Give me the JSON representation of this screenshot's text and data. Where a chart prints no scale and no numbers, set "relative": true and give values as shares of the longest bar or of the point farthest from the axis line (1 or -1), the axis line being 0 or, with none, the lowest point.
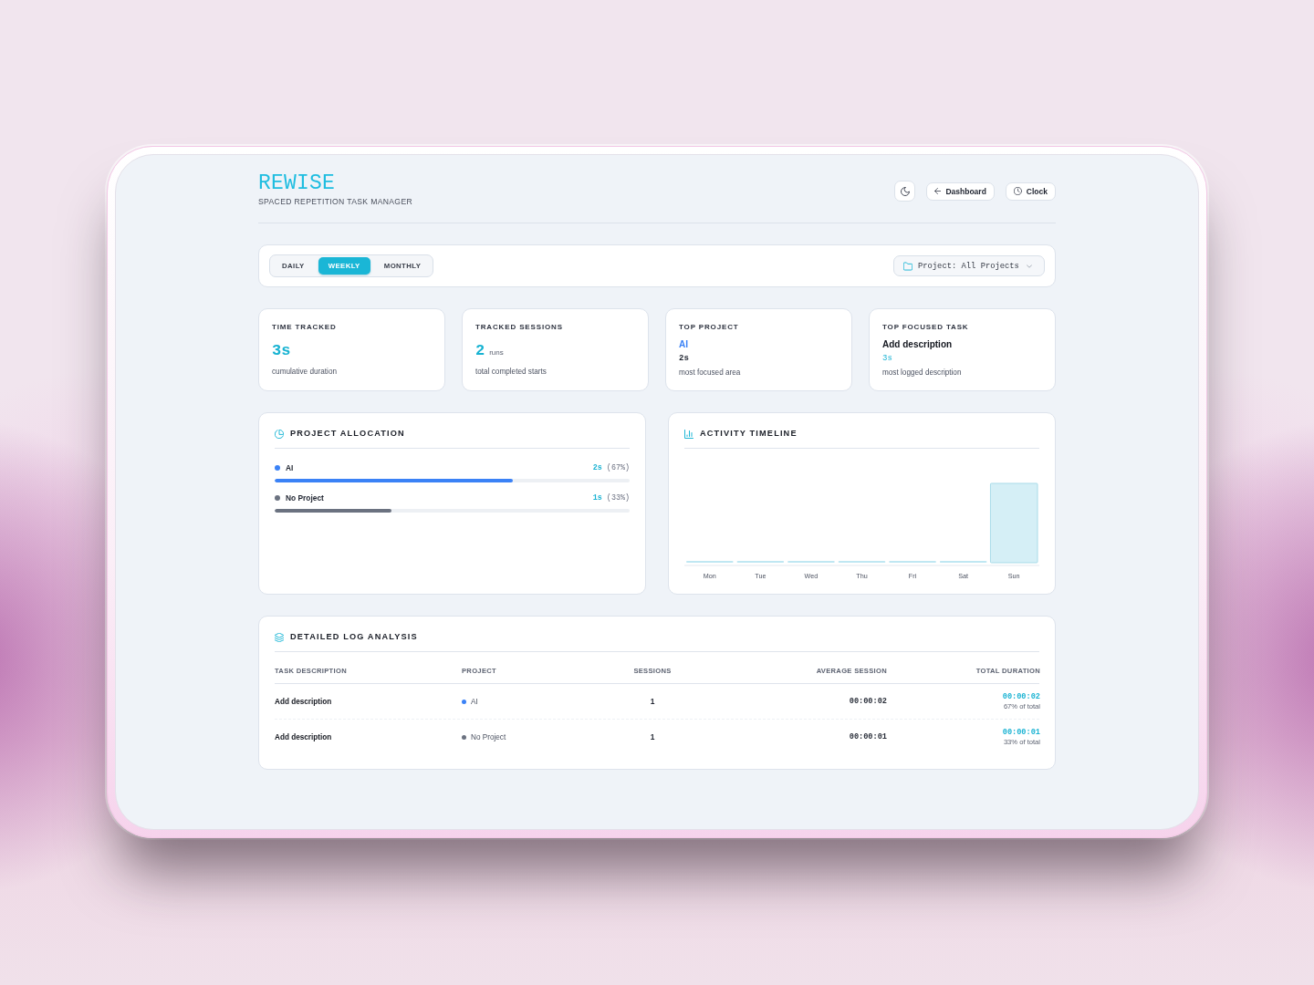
{
  "header": {
    "logo": "REWISE",
    "subtitle": "SPACED REPETITION TASK MANAGER",
    "buttons": [
      {
        "kind": "theme"
      },
      {
        "kind": "back",
        "label": "Dashboard"
      },
      {
        "kind": "clock",
        "label": "Clock"
      }
    ]
  },
  "filter_bar": {
    "tabs": [
      {
        "label": "DAILY",
        "selected": false
      },
      {
        "label": "WEEKLY",
        "selected": true
      },
      {
        "label": "MONTHLY",
        "selected": false
      }
    ],
    "project_select": {
      "value": "Project: All Projects"
    }
  },
  "stats": [
    {
      "kind": "metric",
      "label": "TIME TRACKED",
      "value": "3s",
      "description": "cumulative duration"
    },
    {
      "kind": "metric",
      "label": "TRACKED SESSIONS",
      "value": "2",
      "unit": "runs",
      "description": "total completed starts"
    },
    {
      "kind": "project",
      "label": "TOP PROJECT",
      "name": "AI",
      "value": "2s",
      "description": "most focused area"
    },
    {
      "kind": "task",
      "label": "TOP FOCUSED TASK",
      "name": "Add description",
      "value": "3s",
      "description": "most logged description"
    }
  ],
  "project_allocation": {
    "title": "PROJECT ALLOCATION",
    "items": [
      {
        "name": "AI",
        "color": "#3b82f6",
        "duration": "2s",
        "share": "(67%)",
        "level": 0.67
      },
      {
        "name": "No Project",
        "color": "#6b7280",
        "duration": "1s",
        "share": "(33%)",
        "level": 0.33
      }
    ]
  },
  "activity_timeline": {
    "title": "ACTIVITY TIMELINE",
    "chart_data": {
      "type": "bar",
      "relative": true,
      "categories": [
        "Mon",
        "Tue",
        "Wed",
        "Thu",
        "Fri",
        "Sat",
        "Sun"
      ],
      "values": [
        0,
        0,
        0,
        0,
        0,
        0,
        1
      ]
    }
  },
  "log_analysis": {
    "title": "DETAILED LOG ANALYSIS",
    "columns": [
      "TASK DESCRIPTION",
      "PROJECT",
      "SESSIONS",
      "AVERAGE SESSION",
      "TOTAL DURATION"
    ],
    "rows": [
      {
        "task": "Add description",
        "project": "AI",
        "color": "#3b82f6",
        "sessions": "1",
        "average": "00:00:02",
        "total": "00:00:02",
        "share": "67% of total"
      },
      {
        "task": "Add description",
        "project": "No Project",
        "color": "#6b7280",
        "sessions": "1",
        "average": "00:00:01",
        "total": "00:00:01",
        "share": "33% of total"
      }
    ]
  }
}
